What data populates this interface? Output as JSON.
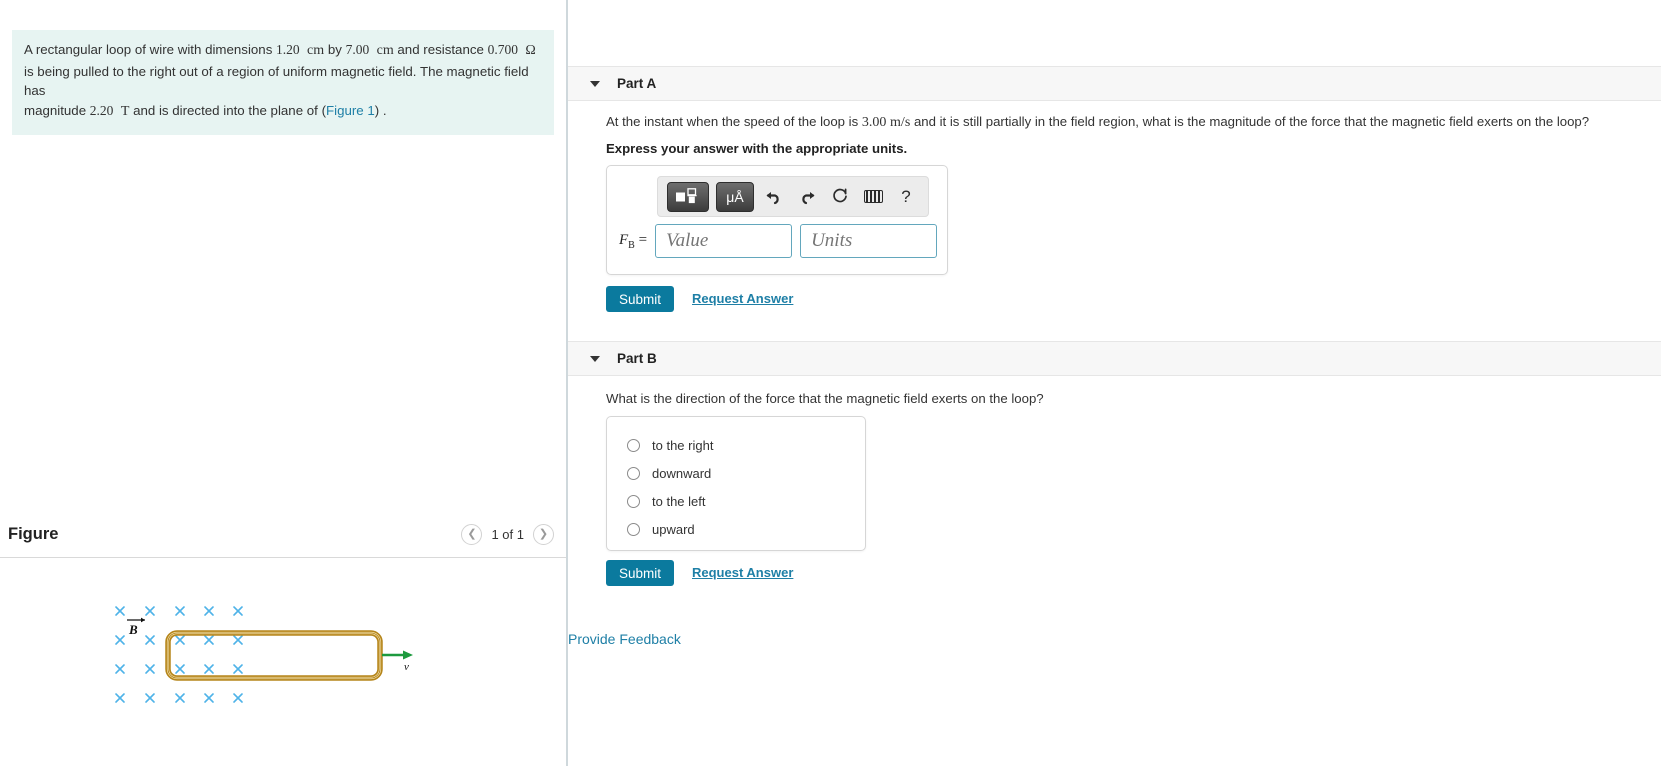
{
  "problem": {
    "text_part1": "A rectangular loop of wire with dimensions ",
    "dim1": "1.20",
    "unit1": "cm",
    "text_by": " by ",
    "dim2": "7.00",
    "unit2": "cm",
    "text_and_res": " and resistance ",
    "resistance": "0.700",
    "unit_ohm": "Ω",
    "line2": "is being pulled to the right out of a region of uniform magnetic field. The magnetic field has",
    "line3_pre": "magnitude ",
    "field_value": "2.20",
    "field_unit": "T",
    "line3_mid": " and is directed into the plane of (",
    "figure_link": "Figure 1",
    "line3_end": ") ."
  },
  "figure_panel": {
    "title": "Figure",
    "pagination": "1 of 1",
    "prev_icon": "chevron-left-icon",
    "next_icon": "chevron-right-icon",
    "labels": {
      "b_field": "B",
      "velocity": "v",
      "cross": "×"
    },
    "colors": {
      "field_cross": "#4fb3e8",
      "loop_wire": "#c9951f",
      "loop_wire_light": "#f3dd9a",
      "velocity_arrow": "#1d9a3e"
    }
  },
  "part_a": {
    "label": "Part A",
    "caret_icon": "caret-down-icon",
    "question_pre": "At the instant when the speed of the loop is ",
    "speed_value": "3.00",
    "speed_unit": "m/s",
    "question_post": " and it is still partially in the field region, what is the magnitude of the force that the magnetic field exerts on the loop?",
    "instruction": "Express your answer with the appropriate units.",
    "toolbar": {
      "template_icon": "math-template-icon",
      "units_label": "μÅ",
      "undo_icon": "undo-arrow-icon",
      "redo_icon": "redo-arrow-icon",
      "reset_icon": "reset-circle-icon",
      "keyboard_icon": "keyboard-icon",
      "help_label": "?"
    },
    "answer": {
      "symbol": "F",
      "subscript": "B",
      "equals": "=",
      "value_placeholder": "Value",
      "units_placeholder": "Units",
      "value": "",
      "units": ""
    },
    "submit_label": "Submit",
    "request_answer_label": "Request Answer"
  },
  "part_b": {
    "label": "Part B",
    "caret_icon": "caret-down-icon",
    "question": "What is the direction of the force that the magnetic field exerts on the loop?",
    "options": [
      {
        "label": "to the right",
        "selected": false
      },
      {
        "label": "downward",
        "selected": false
      },
      {
        "label": "to the left",
        "selected": false
      },
      {
        "label": "upward",
        "selected": false
      }
    ],
    "submit_label": "Submit",
    "request_answer_label": "Request Answer"
  },
  "footer": {
    "feedback_label": "Provide Feedback"
  },
  "theme": {
    "accent": "#0b7a9e",
    "link": "#1e7fa6",
    "problem_bg": "#e7f4f2",
    "panel_header_bg": "#f7f7f7"
  }
}
